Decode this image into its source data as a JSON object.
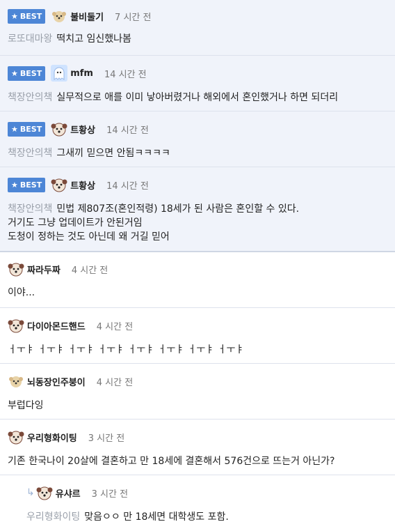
{
  "badge_label": "BEST",
  "comments": [
    {
      "nick": "불비둘기",
      "time": "7 시간 전",
      "tag": "로또대마왕",
      "lines": [
        "떡치고 임신했나봄"
      ]
    },
    {
      "nick": "mfm",
      "time": "14 시간 전",
      "tag": "책장안의책",
      "lines": [
        "실무적으로 애를 이미 낳아버렸거나 해외에서 혼인했거나 하면 되더리"
      ]
    },
    {
      "nick": "트황상",
      "time": "14 시간 전",
      "tag": "책장안의책",
      "lines": [
        "그새끼 믿으면 안됨ㅋㅋㅋㅋ"
      ]
    },
    {
      "nick": "트황상",
      "time": "14 시간 전",
      "tag": "책장안의책",
      "lines": [
        "민법 제807조(혼인적령) 18세가 된 사람은 혼인할 수 있다.",
        "거기도 그냥 업데이트가 안된거임",
        "도청이 정하는 것도 아닌데 왜 거길 믿어"
      ]
    },
    {
      "nick": "짜라두짜",
      "time": "4 시간 전",
      "lines": [
        "이야..."
      ]
    },
    {
      "nick": "다이아몬드핸드",
      "time": "4 시간 전",
      "lines": [
        "ㅓㅜㅑ ㅓㅜㅑ ㅓㅜㅑ ㅓㅜㅑ ㅓㅜㅑ ㅓㅜㅑ ㅓㅜㅑ ㅓㅜㅑ"
      ]
    },
    {
      "nick": "뇌동장인주붕이",
      "time": "4 시간 전",
      "lines": [
        "부럽다잉"
      ]
    },
    {
      "nick": "우리형화이팅",
      "time": "3 시간 전",
      "lines": [
        "기존 한국나이 20살에 결혼하고 만 18세에 결혼해서 576건으로 뜨는거 아닌가?"
      ]
    },
    {
      "nick": "유샤르",
      "time": "3 시간 전",
      "tag": "우리형화이팅",
      "lines": [
        "맞음ㅇㅇ 만 18세면 대학생도 포함."
      ]
    }
  ]
}
